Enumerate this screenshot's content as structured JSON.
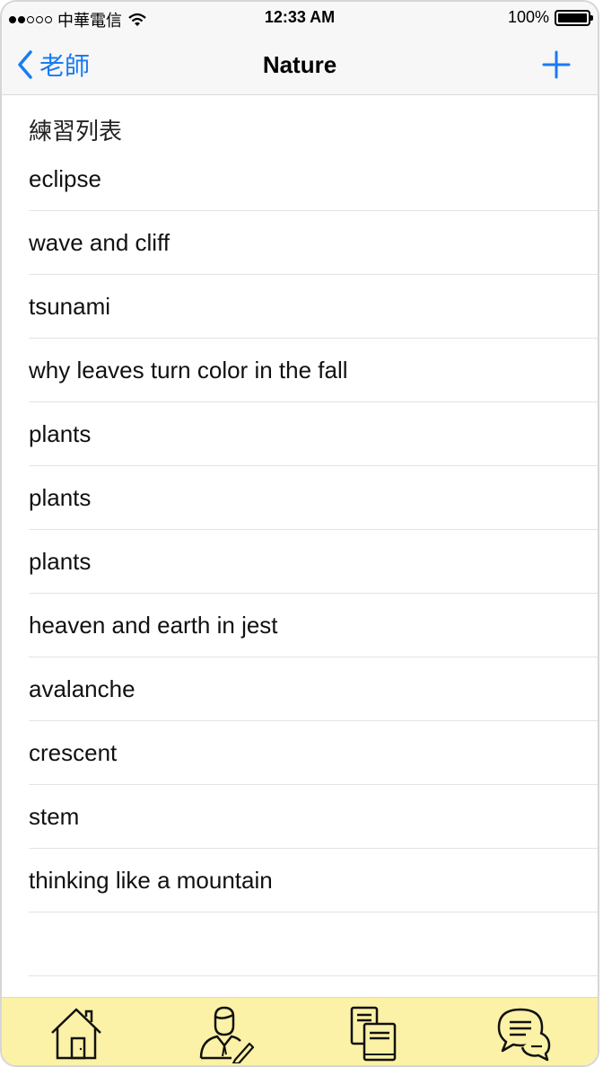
{
  "status_bar": {
    "carrier": "中華電信",
    "time": "12:33 AM",
    "battery": "100%"
  },
  "nav": {
    "back_label": "老師",
    "title": "Nature",
    "add_icon": "plus-icon"
  },
  "section": {
    "header": "練習列表"
  },
  "items": [
    "eclipse",
    "wave and cliff",
    "tsunami",
    "why leaves turn color in the fall",
    "plants",
    "plants",
    "plants",
    "heaven and earth in jest",
    "avalanche",
    "crescent",
    "stem",
    "thinking like a mountain",
    ""
  ],
  "tabs": [
    {
      "icon": "home-icon"
    },
    {
      "icon": "teacher-icon"
    },
    {
      "icon": "books-icon"
    },
    {
      "icon": "chat-icon"
    }
  ],
  "colors": {
    "accent": "#1a7bf2",
    "tab_bar_bg": "#fbf2a7"
  }
}
